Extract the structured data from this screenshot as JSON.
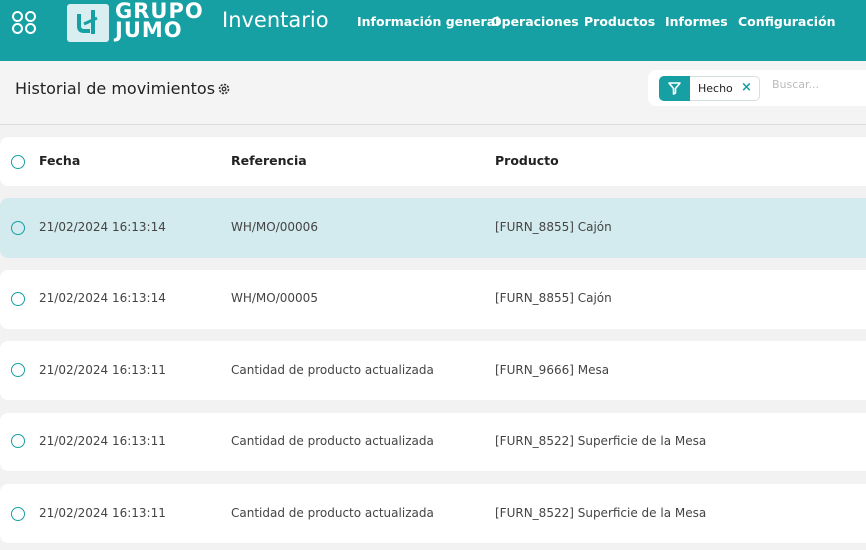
{
  "navbar": {
    "brand_line1": "GRUPO",
    "brand_line2": "JUMO",
    "app_title": "Inventario",
    "menu": [
      "Información general",
      "Operaciones",
      "Productos",
      "Informes",
      "Configuración"
    ]
  },
  "control_panel": {
    "breadcrumb": "Historial de movimientos",
    "facet_label": "Hecho",
    "facet_remove": "×",
    "search_placeholder": "Buscar..."
  },
  "table": {
    "columns": [
      "Fecha",
      "Referencia",
      "Producto"
    ],
    "rows": [
      {
        "fecha": "21/02/2024 16:13:14",
        "referencia": "WH/MO/00006",
        "producto": "[FURN_8855] Cajón",
        "selected": true
      },
      {
        "fecha": "21/02/2024 16:13:14",
        "referencia": "WH/MO/00005",
        "producto": "[FURN_8855] Cajón",
        "selected": false
      },
      {
        "fecha": "21/02/2024 16:13:11",
        "referencia": "Cantidad de producto actualizada",
        "producto": "[FURN_9666] Mesa",
        "selected": false
      },
      {
        "fecha": "21/02/2024 16:13:11",
        "referencia": "Cantidad de producto actualizada",
        "producto": "[FURN_8522] Superficie de la Mesa",
        "selected": false
      },
      {
        "fecha": "21/02/2024 16:13:11",
        "referencia": "Cantidad de producto actualizada",
        "producto": "[FURN_8522] Superficie de la Mesa",
        "selected": false
      }
    ]
  },
  "colors": {
    "brand": "#16a0a3",
    "selected_row": "#d3ebee",
    "background": "#f2f2f2"
  },
  "icons": [
    "apps-grid-icon",
    "brand-logo-icon",
    "gear-icon",
    "filter-icon",
    "close-icon",
    "radio-icon"
  ]
}
